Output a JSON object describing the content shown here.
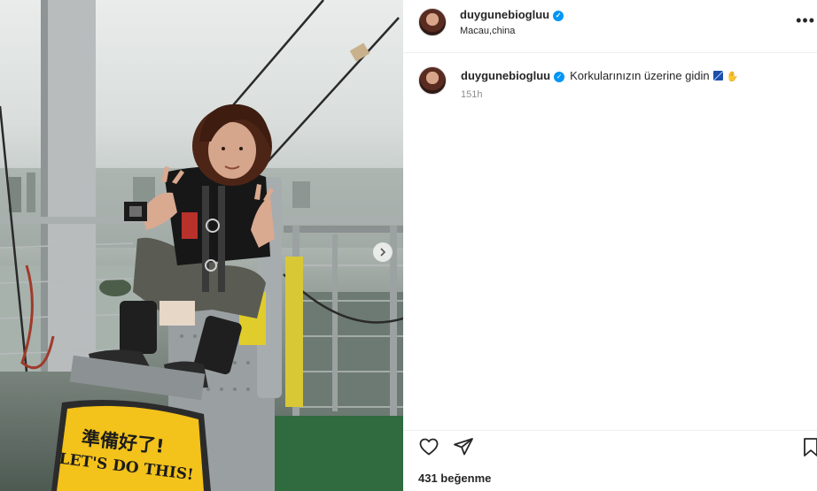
{
  "post": {
    "username": "duygunebiogluu",
    "location": "Macau,china",
    "caption": "Korkularınızın üzerine gidin",
    "time_ago": "151h",
    "likes_text": "431 beğenme",
    "verified": true
  },
  "photo": {
    "sign_line1": "準備好了!",
    "sign_line2": "LET'S DO THIS!"
  },
  "icons": {
    "verified": "verified-badge-icon",
    "more": "more-options-icon",
    "like": "heart-icon",
    "share": "paper-plane-icon",
    "save": "bookmark-icon",
    "next": "chevron-right-icon"
  },
  "colors": {
    "verified_blue": "#0095f6",
    "sign_yellow": "#f3c21b",
    "text_primary": "#262626",
    "text_secondary": "#8e8e8e"
  }
}
